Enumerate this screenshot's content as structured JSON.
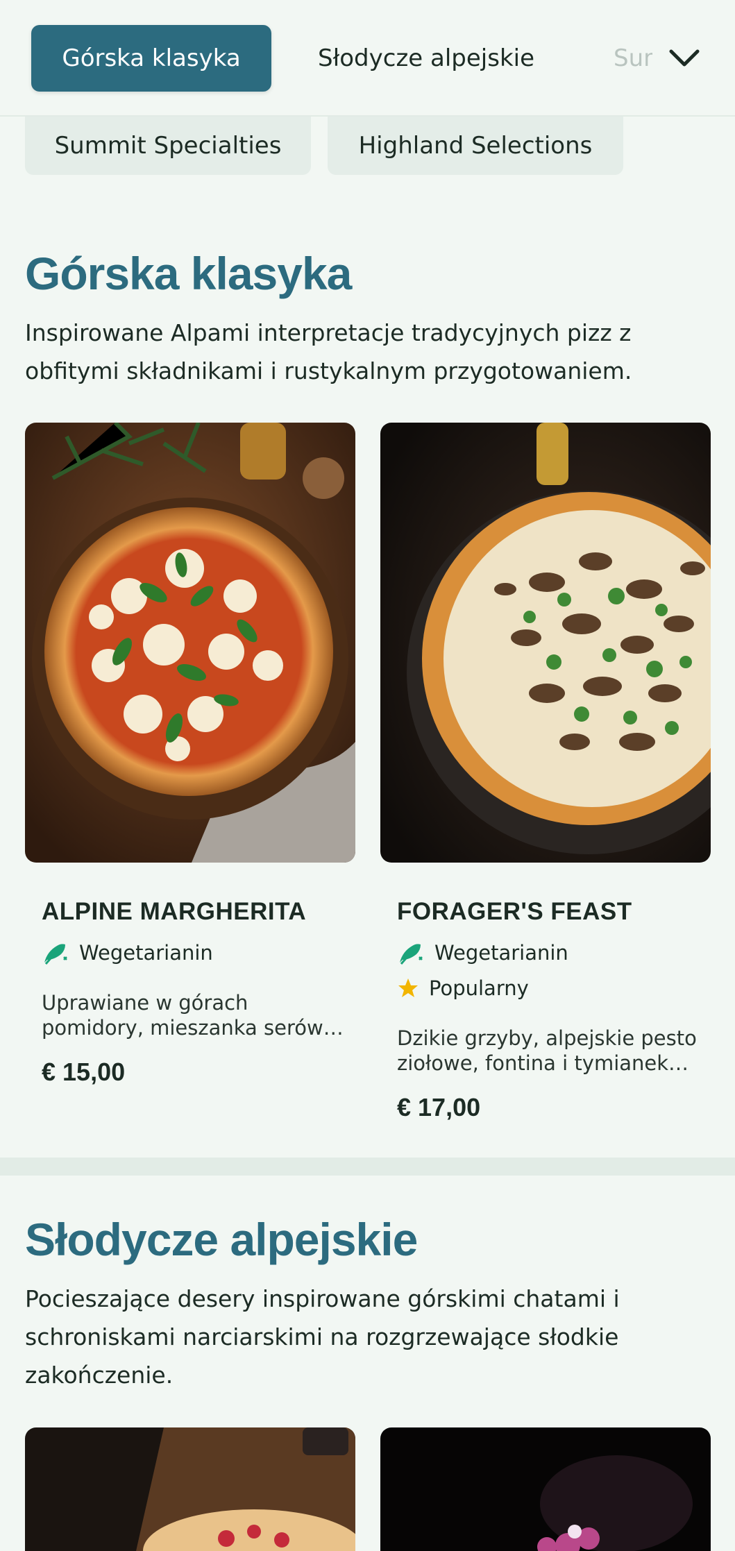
{
  "nav": {
    "tabs": [
      {
        "label": "Górska klasyka",
        "active": true
      },
      {
        "label": "Słodycze alpejskie",
        "active": false
      },
      {
        "label": "Summit Specialties",
        "active": false
      }
    ],
    "overflow": [
      {
        "label": "Summit Specialties"
      },
      {
        "label": "Highland Selections"
      }
    ],
    "expand_icon": "chevron-down-icon"
  },
  "sections": [
    {
      "title": "Górska klasyka",
      "description": "Inspirowane Alpami interpretacje tradycyjnych pizz z obfitymi składnikami i rustykalnym przygotowaniem.",
      "items": [
        {
          "name": "ALPINE MARGHERITA",
          "tags": [
            {
              "label": "Wegetarianin",
              "icon": "vegetarian-icon"
            }
          ],
          "description": "Uprawiane w górach pomidory, mieszanka serów…",
          "price": "€ 15,00"
        },
        {
          "name": "FORAGER'S FEAST",
          "tags": [
            {
              "label": "Wegetarianin",
              "icon": "vegetarian-icon"
            },
            {
              "label": "Popularny",
              "icon": "star-icon"
            }
          ],
          "description": "Dzikie grzyby, alpejskie pesto ziołowe, fontina i tymianek…",
          "price": "€ 17,00"
        }
      ]
    },
    {
      "title": "Słodycze alpejskie",
      "description": "Pocieszające desery inspirowane górskimi chatami i schroniskami narciarskimi na rozgrzewające słodkie zakończenie."
    }
  ],
  "colors": {
    "accent": "#2c6b7f",
    "background": "#f2f7f3",
    "vegetarian": "#1aa47a",
    "star": "#f2b500"
  }
}
